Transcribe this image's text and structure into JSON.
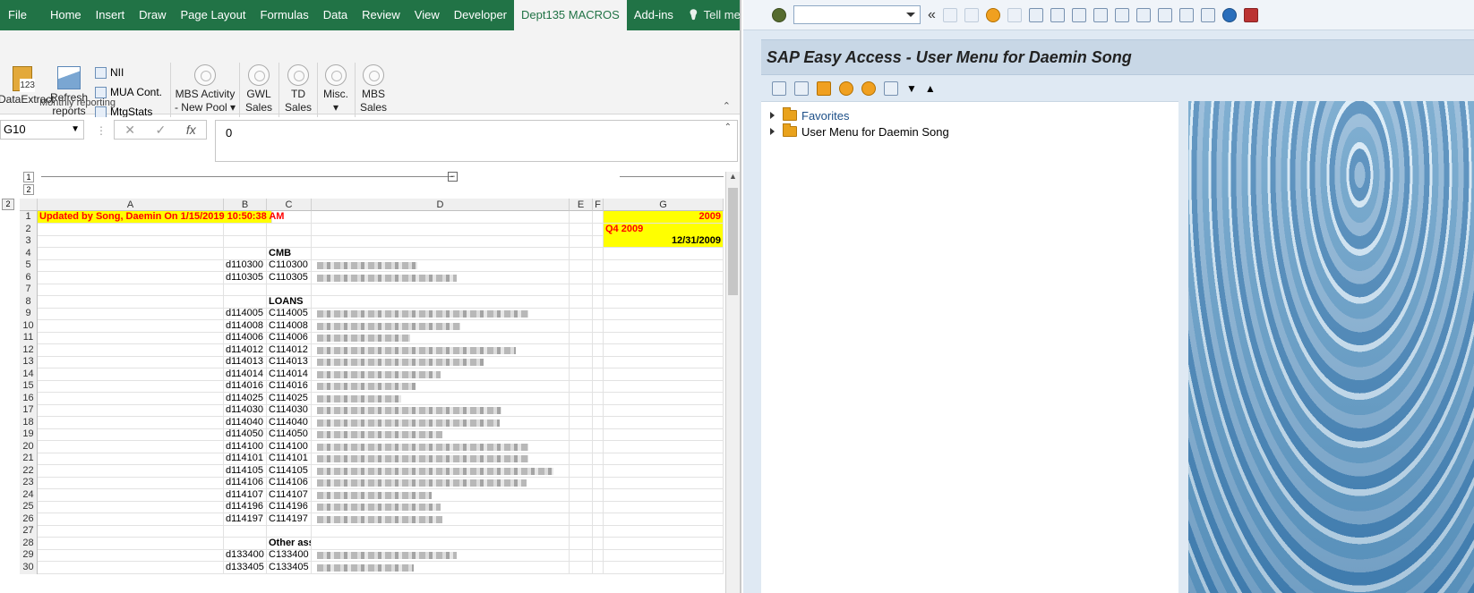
{
  "excel": {
    "tabs": [
      "File",
      "Home",
      "Insert",
      "Draw",
      "Page Layout",
      "Formulas",
      "Data",
      "Review",
      "View",
      "Developer",
      "Dept135 MACROS",
      "Add-ins"
    ],
    "active_tab": "Dept135 MACROS",
    "tell_me": "Tell me",
    "ribbon": {
      "data_extract": "DataExtract",
      "refresh_1": "Refresh",
      "refresh_2": "reports",
      "nii": "NII",
      "mua": "MUA Cont.",
      "mtg": "MtgStats",
      "mbs_activity_1": "MBS Activity",
      "mbs_activity_2": "- New Pool",
      "gwl_1": "GWL",
      "gwl_2": "Sales",
      "td_1": "TD",
      "td_2": "Sales",
      "misc": "Misc.",
      "mbs_1": "MBS",
      "mbs_2": "Sales",
      "group": "Monthly reporting"
    },
    "name_box": "G10",
    "formula_value": "0",
    "outline_levels": [
      "1",
      "2"
    ],
    "columns": [
      {
        "label": "A"
      },
      {
        "label": "B"
      },
      {
        "label": "C"
      },
      {
        "label": "D"
      },
      {
        "label": "E"
      },
      {
        "label": "F"
      },
      {
        "label": "G"
      }
    ],
    "rows": [
      {
        "n": "1",
        "a": "Updated by Song, Daemin On 1/15/2019 10:50:38 AM",
        "b": "",
        "c": "",
        "g": "2009",
        "blur": false
      },
      {
        "n": "2",
        "a": "",
        "b": "",
        "c": "",
        "g": "Q4 2009",
        "blur": false
      },
      {
        "n": "3",
        "a": "",
        "b": "",
        "c": "",
        "g": "12/31/2009",
        "blur": false
      },
      {
        "n": "4",
        "a": "",
        "b": "",
        "c": "CMB",
        "g": "",
        "blur": false
      },
      {
        "n": "5",
        "a": "",
        "b": "d110300",
        "c": "C110300",
        "g": "",
        "blur": true
      },
      {
        "n": "6",
        "a": "",
        "b": "d110305",
        "c": "C110305",
        "g": "",
        "blur": true
      },
      {
        "n": "7",
        "a": "",
        "b": "",
        "c": "",
        "g": "",
        "blur": false
      },
      {
        "n": "8",
        "a": "",
        "b": "",
        "c": "LOANS",
        "g": "",
        "blur": false
      },
      {
        "n": "9",
        "a": "",
        "b": "d114005",
        "c": "C114005",
        "g": "",
        "blur": true
      },
      {
        "n": "10",
        "a": "",
        "b": "d114008",
        "c": "C114008",
        "g": "",
        "blur": true
      },
      {
        "n": "11",
        "a": "",
        "b": "d114006",
        "c": "C114006",
        "g": "",
        "blur": true
      },
      {
        "n": "12",
        "a": "",
        "b": "d114012",
        "c": "C114012",
        "g": "",
        "blur": true
      },
      {
        "n": "13",
        "a": "",
        "b": "d114013",
        "c": "C114013",
        "g": "",
        "blur": true
      },
      {
        "n": "14",
        "a": "",
        "b": "d114014",
        "c": "C114014",
        "g": "",
        "blur": true
      },
      {
        "n": "15",
        "a": "",
        "b": "d114016",
        "c": "C114016",
        "g": "",
        "blur": true
      },
      {
        "n": "16",
        "a": "",
        "b": "d114025",
        "c": "C114025",
        "g": "",
        "blur": true
      },
      {
        "n": "17",
        "a": "",
        "b": "d114030",
        "c": "C114030",
        "g": "",
        "blur": true
      },
      {
        "n": "18",
        "a": "",
        "b": "d114040",
        "c": "C114040",
        "g": "",
        "blur": true
      },
      {
        "n": "19",
        "a": "",
        "b": "d114050",
        "c": "C114050",
        "g": "",
        "blur": true
      },
      {
        "n": "20",
        "a": "",
        "b": "d114100",
        "c": "C114100",
        "g": "",
        "blur": true
      },
      {
        "n": "21",
        "a": "",
        "b": "d114101",
        "c": "C114101",
        "g": "",
        "blur": true
      },
      {
        "n": "22",
        "a": "",
        "b": "d114105",
        "c": "C114105",
        "g": "",
        "blur": true
      },
      {
        "n": "23",
        "a": "",
        "b": "d114106",
        "c": "C114106",
        "g": "",
        "blur": true
      },
      {
        "n": "24",
        "a": "",
        "b": "d114107",
        "c": "C114107",
        "g": "",
        "blur": true
      },
      {
        "n": "25",
        "a": "",
        "b": "d114196",
        "c": "C114196",
        "g": "",
        "blur": true
      },
      {
        "n": "26",
        "a": "",
        "b": "d114197",
        "c": "C114197",
        "g": "",
        "blur": true
      },
      {
        "n": "27",
        "a": "",
        "b": "",
        "c": "",
        "g": "",
        "blur": false
      },
      {
        "n": "28",
        "a": "",
        "b": "",
        "c": "Other ass",
        "g": "",
        "blur": false
      },
      {
        "n": "29",
        "a": "",
        "b": "d133400",
        "c": "C133400",
        "g": "",
        "blur": true
      },
      {
        "n": "30",
        "a": "",
        "b": "d133405",
        "c": "C133405",
        "g": "",
        "blur": true
      }
    ]
  },
  "sap": {
    "title": "SAP Easy Access  -  User Menu for Daemin Song",
    "tree": [
      "Favorites",
      "User Menu for Daemin Song"
    ]
  },
  "colors": {
    "excel_green": "#217346",
    "header_yellow": "#ffff00",
    "update_red": "#ff0000"
  }
}
